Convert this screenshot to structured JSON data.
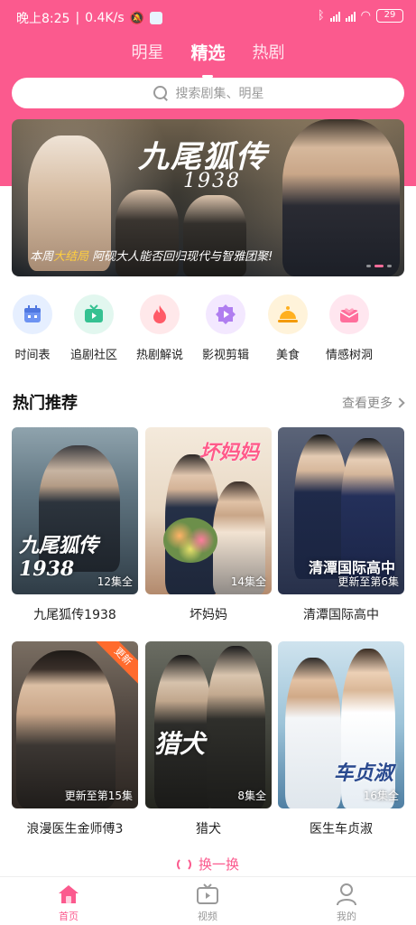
{
  "status_bar": {
    "time": "晚上8:25",
    "network_speed": "0.4K/s",
    "battery": "29"
  },
  "tabs": [
    {
      "label": "明星",
      "active": false
    },
    {
      "label": "精选",
      "active": true
    },
    {
      "label": "热剧",
      "active": false
    }
  ],
  "search": {
    "placeholder": "搜索剧集、明星"
  },
  "banner": {
    "title": "九尾狐传",
    "year": "1938",
    "caption_prefix": "本周",
    "caption_highlight": "大结局",
    "caption_rest": " 阿砚大人能否回归现代与智雅团聚!"
  },
  "categories": [
    {
      "label": "时间表",
      "icon": "calendar-icon",
      "bg": "#e6efff",
      "color": "#6d93f2"
    },
    {
      "label": "追剧社区",
      "icon": "tv-icon",
      "bg": "#e2f7ef",
      "color": "#35c191"
    },
    {
      "label": "热剧解说",
      "icon": "flame-icon",
      "bg": "#ffe8ea",
      "color": "#ff5b67"
    },
    {
      "label": "影视剪辑",
      "icon": "play-badge-icon",
      "bg": "#f3e8ff",
      "color": "#b07ef0"
    },
    {
      "label": "美食",
      "icon": "food-cloche-icon",
      "bg": "#fff3da",
      "color": "#ffb020"
    },
    {
      "label": "情感树洞",
      "icon": "heart-mail-icon",
      "bg": "#ffe6ef",
      "color": "#ff6f9c"
    }
  ],
  "section": {
    "title": "热门推荐",
    "more_label": "查看更多"
  },
  "shows": [
    {
      "name": "九尾狐传1938",
      "episodes": "12集全",
      "poster_text": "九尾狐传\n1938",
      "poster_bg": "linear-gradient(180deg,#8fa3ad 0%,#5f7480 40%,#2f3c46 100%)"
    },
    {
      "name": "坏妈妈",
      "episodes": "14集全",
      "poster_text": "坏妈妈",
      "poster_bg": "linear-gradient(180deg,#f4eadc 0%,#e8d8c4 50%,#b38a6d 100%)"
    },
    {
      "name": "清潭国际高中",
      "episodes": "更新至第6集",
      "poster_text": "清潭国际高中",
      "poster_bg": "linear-gradient(180deg,#5b6478 0%,#3d4660 50%,#27304a 100%)"
    },
    {
      "name": "浪漫医生金师傅3",
      "episodes": "更新至第15集",
      "poster_text": "",
      "badge": "更新",
      "poster_bg": "linear-gradient(180deg,#7a6e62 0%,#4b423c 50%,#2b2521 100%)"
    },
    {
      "name": "猎犬",
      "episodes": "8集全",
      "poster_text": "猎犬",
      "poster_bg": "linear-gradient(180deg,#6b6d63 0%,#45473f 50%,#24251f 100%)"
    },
    {
      "name": "医生车贞淑",
      "episodes": "16集全",
      "poster_text": "车贞淑",
      "poster_bg": "linear-gradient(180deg,#cfe3ee 0%,#9cc3d8 50%,#4f7fa3 100%)"
    }
  ],
  "refresh_label": "换一换",
  "bottom_nav": [
    {
      "label": "首页",
      "active": true
    },
    {
      "label": "视频",
      "active": false
    },
    {
      "label": "我的",
      "active": false
    }
  ],
  "colors": {
    "accent": "#fb5a8e",
    "highlight": "#ffcf3f"
  }
}
